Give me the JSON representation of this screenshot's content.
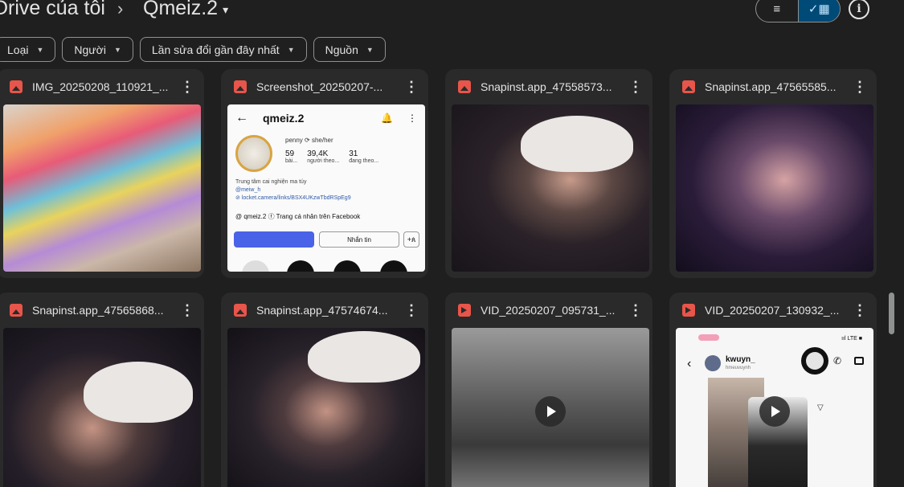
{
  "breadcrumb": {
    "root": "Drive của tôi",
    "separator": "›",
    "current": "Qmeiz.2",
    "current_caret": "▾"
  },
  "view_toggle": {
    "list_icon": "≡",
    "grid_check": "✓",
    "grid_icon": "▦"
  },
  "info_button": {
    "icon": "i"
  },
  "filters": [
    {
      "label": "Loại"
    },
    {
      "label": "Người"
    },
    {
      "label": "Lần sửa đổi gần đây nhất"
    },
    {
      "label": "Nguồn"
    }
  ],
  "files": [
    {
      "name": "IMG_20250208_110921_...",
      "type": "image"
    },
    {
      "name": "Screenshot_20250207-...",
      "type": "image"
    },
    {
      "name": "Snapinst.app_47558573...",
      "type": "image"
    },
    {
      "name": "Snapinst.app_47565585...",
      "type": "image"
    },
    {
      "name": "Snapinst.app_47565868...",
      "type": "image"
    },
    {
      "name": "Snapinst.app_47574674...",
      "type": "image"
    },
    {
      "name": "VID_20250207_095731_...",
      "type": "video"
    },
    {
      "name": "VID_20250207_130932_...",
      "type": "video"
    }
  ],
  "more_icon": "⋮",
  "ig_screenshot": {
    "back": "←",
    "username": "qmeiz.2",
    "bell": "🔔",
    "kebab": "⋮",
    "pronouns": "penny ⟳ she/her",
    "stats": [
      {
        "n": "59",
        "label": "bài..."
      },
      {
        "n": "39,4K",
        "label": "người theo..."
      },
      {
        "n": "31",
        "label": "đang theo..."
      }
    ],
    "bio_line1": "Trung tâm cai nghiện ma túy",
    "bio_line2": "@meiw_h",
    "bio_line3": "⊘ locket.camera/links/BSX4UKzwTbdRSpEg9",
    "threads": "@ qmeiz.2   ⓕ Trang cá nhân trên Facebook",
    "message": "Nhắn tin",
    "add": "+ጰ"
  },
  "chat_screenshot": {
    "signal": "ııl LTE ■",
    "back": "‹",
    "name": "kwuyn_",
    "sub": "hmeuvuynh",
    "phone": "✆",
    "send": "▽"
  }
}
